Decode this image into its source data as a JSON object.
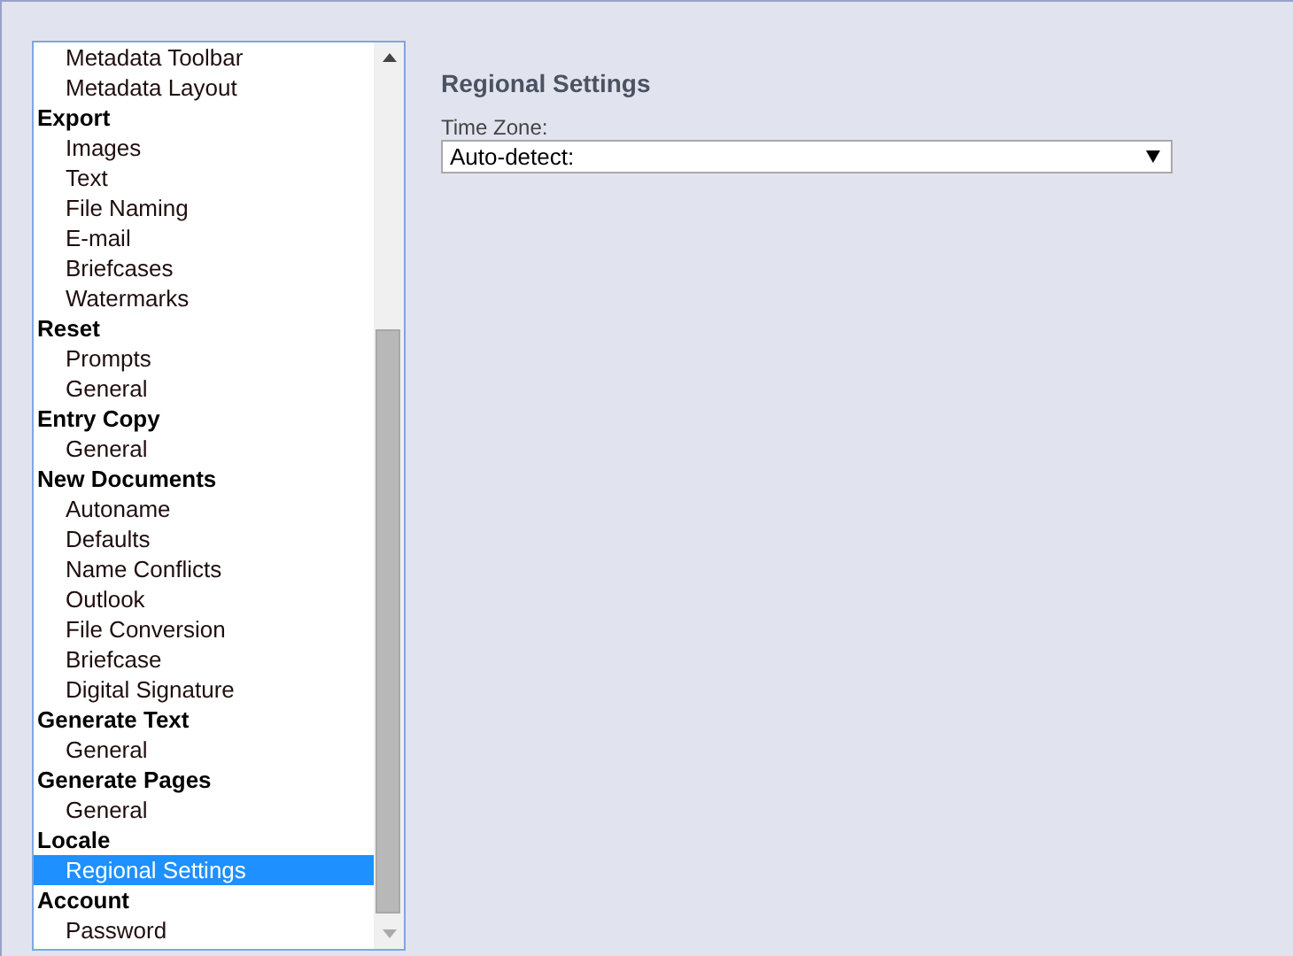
{
  "sidebar": {
    "groups": [
      {
        "children": [
          {
            "label": "Metadata Toolbar",
            "selected": false
          },
          {
            "label": "Metadata Layout",
            "selected": false
          }
        ]
      },
      {
        "label": "Export",
        "children": [
          {
            "label": "Images",
            "selected": false
          },
          {
            "label": "Text",
            "selected": false
          },
          {
            "label": "File Naming",
            "selected": false
          },
          {
            "label": "E-mail",
            "selected": false
          },
          {
            "label": "Briefcases",
            "selected": false
          },
          {
            "label": "Watermarks",
            "selected": false
          }
        ]
      },
      {
        "label": "Reset",
        "children": [
          {
            "label": "Prompts",
            "selected": false
          },
          {
            "label": "General",
            "selected": false
          }
        ]
      },
      {
        "label": "Entry Copy",
        "children": [
          {
            "label": "General",
            "selected": false
          }
        ]
      },
      {
        "label": "New Documents",
        "children": [
          {
            "label": "Autoname",
            "selected": false
          },
          {
            "label": "Defaults",
            "selected": false
          },
          {
            "label": "Name Conflicts",
            "selected": false
          },
          {
            "label": "Outlook",
            "selected": false
          },
          {
            "label": "File Conversion",
            "selected": false
          },
          {
            "label": "Briefcase",
            "selected": false
          },
          {
            "label": "Digital Signature",
            "selected": false
          }
        ]
      },
      {
        "label": "Generate Text",
        "children": [
          {
            "label": "General",
            "selected": false
          }
        ]
      },
      {
        "label": "Generate Pages",
        "children": [
          {
            "label": "General",
            "selected": false
          }
        ]
      },
      {
        "label": "Locale",
        "children": [
          {
            "label": "Regional Settings",
            "selected": true
          }
        ]
      },
      {
        "label": "Account",
        "children": [
          {
            "label": "Password",
            "selected": false
          }
        ]
      }
    ]
  },
  "panel": {
    "title": "Regional Settings",
    "fields": [
      {
        "label": "Time Zone:",
        "value": "Auto-detect:"
      }
    ]
  }
}
